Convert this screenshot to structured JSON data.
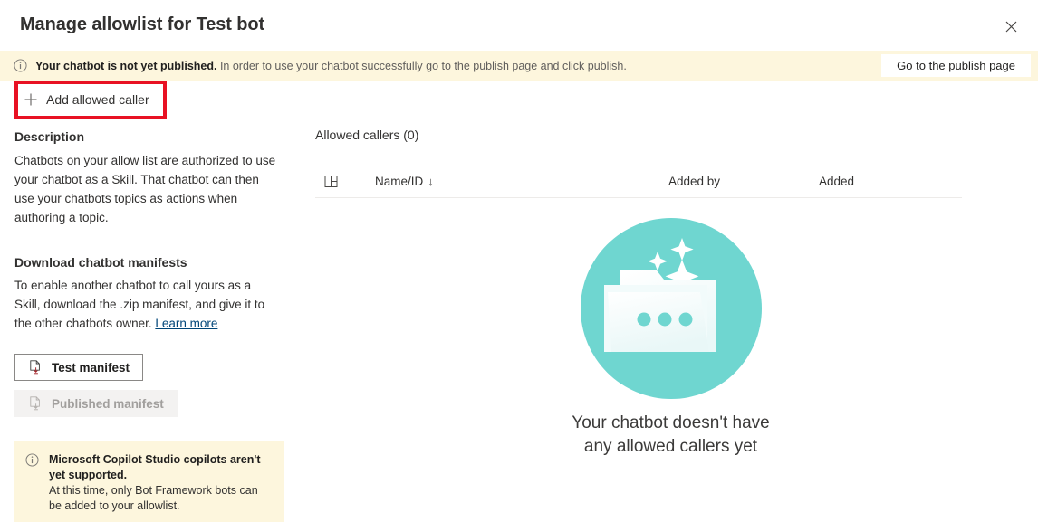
{
  "dialog": {
    "title": "Manage allowlist for Test bot",
    "close_icon": "close-icon"
  },
  "banner": {
    "icon": "info-circle-icon",
    "bold_text": "Your chatbot is not yet published.",
    "rest_text": " In order to use your chatbot successfully go to the publish page and click publish.",
    "action_label": "Go to the publish page",
    "background": "#fdf6dd"
  },
  "commandbar": {
    "add_icon": "plus-icon",
    "add_label": "Add allowed caller",
    "highlight_color": "#e81123"
  },
  "left_panel": {
    "description_heading": "Description",
    "description_body": "Chatbots on your allow list are authorized to use your chatbot as a Skill. That chatbot can then use your chatbots topics as actions when authoring a topic.",
    "download_heading": "Download chatbot manifests",
    "download_body": "To enable another chatbot to call yours as a Skill, download the .zip manifest, and give it to the other chatbots owner. ",
    "learn_more_label": "Learn more",
    "test_manifest_label": "Test manifest",
    "test_manifest_icon": "document-download-icon",
    "published_manifest_label": "Published manifest",
    "published_manifest_icon": "document-download-icon",
    "info_card": {
      "icon": "info-circle-icon",
      "bold_text": "Microsoft Copilot Studio copilots aren't yet supported.",
      "body_text": "At this time, only Bot Framework bots can be added to your allowlist.",
      "background": "#fdf6dd"
    }
  },
  "list": {
    "heading": "Allowed callers (0)",
    "columns_icon": "column-options-icon",
    "columns": [
      {
        "label": "Name/ID",
        "sort_indicator": "↓"
      },
      {
        "label": "Added by",
        "sort_indicator": ""
      },
      {
        "label": "Added",
        "sort_indicator": ""
      }
    ],
    "rows": [],
    "empty_state": {
      "illustration": "empty-folder-sparkles-illustration",
      "circle_color": "#6fd6d0",
      "message": "Your chatbot doesn't have any allowed callers yet"
    }
  }
}
